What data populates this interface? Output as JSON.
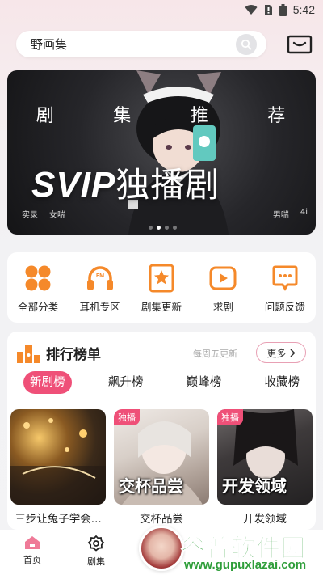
{
  "status_bar": {
    "time": "5:42",
    "icons": [
      "wifi-icon",
      "sim-icon",
      "battery-icon"
    ]
  },
  "search": {
    "text": "野画集",
    "icon": "search-icon"
  },
  "header": {
    "mail_icon": "mail-icon"
  },
  "banner": {
    "category_chars": [
      "剧",
      "集",
      "推",
      "荐"
    ],
    "title_latin": "SVIP",
    "title_cjk": "独播剧",
    "left_tags": [
      "实录",
      "女喘"
    ],
    "right_tags": [
      "男喘",
      "4i"
    ],
    "dots_total": 4,
    "dots_active": 1
  },
  "quick_nav": [
    {
      "label": "全部分类",
      "icon": "grid-icon"
    },
    {
      "label": "耳机专区",
      "icon": "headphones-icon"
    },
    {
      "label": "剧集更新",
      "icon": "star-bookmark-icon"
    },
    {
      "label": "求剧",
      "icon": "play-icon"
    },
    {
      "label": "问题反馈",
      "icon": "chat-bubble-icon"
    }
  ],
  "ranking": {
    "title": "排行榜单",
    "update_note": "每周五更新",
    "more_label": "更多",
    "tabs": [
      "新剧榜",
      "飙升榜",
      "巅峰榜",
      "收藏榜"
    ],
    "active_tab": 0,
    "items": [
      {
        "name": "三步让兔子学会...",
        "badge": "",
        "cover_text": ""
      },
      {
        "name": "交杯品尝",
        "badge": "独播",
        "cover_text": "交杯品尝"
      },
      {
        "name": "开发领域",
        "badge": "独播",
        "cover_text": "开发领域"
      }
    ]
  },
  "bottom_nav": [
    {
      "label": "首页",
      "icon": "home-icon"
    },
    {
      "label": "剧集",
      "icon": "gear-icon"
    }
  ],
  "watermark": {
    "title": "谷普软件园",
    "url": "www.gupuxlazai.com"
  },
  "colors": {
    "accent": "#ef5078",
    "orange": "#f5892a",
    "banner_bg": "#26262a"
  }
}
